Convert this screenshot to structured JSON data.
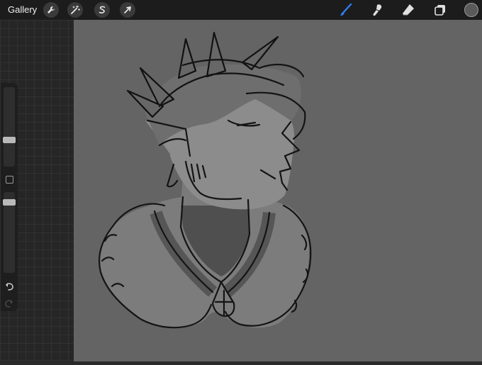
{
  "topbar": {
    "gallery_label": "Gallery",
    "left_tools": [
      {
        "name": "actions",
        "icon": "wrench-icon"
      },
      {
        "name": "adjustments",
        "icon": "magic-wand-icon"
      },
      {
        "name": "selection",
        "icon": "selection-s-icon"
      },
      {
        "name": "transform",
        "icon": "arrow-cursor-icon"
      }
    ],
    "right_tools": [
      {
        "name": "brush",
        "icon": "brush-icon",
        "active": true
      },
      {
        "name": "smudge",
        "icon": "smudge-icon"
      },
      {
        "name": "eraser",
        "icon": "eraser-icon"
      },
      {
        "name": "layers",
        "icon": "layers-icon"
      }
    ],
    "current_color": "#5a5a5a"
  },
  "sidebar": {
    "brush_size_level": 0.8,
    "opacity_level": 0.97,
    "buttons": [
      "modify-button",
      "undo-button",
      "redo-button"
    ]
  },
  "colors": {
    "accent": "#2f7ff5",
    "canvas": "#646464",
    "toolbar": "#1c1c1c"
  }
}
